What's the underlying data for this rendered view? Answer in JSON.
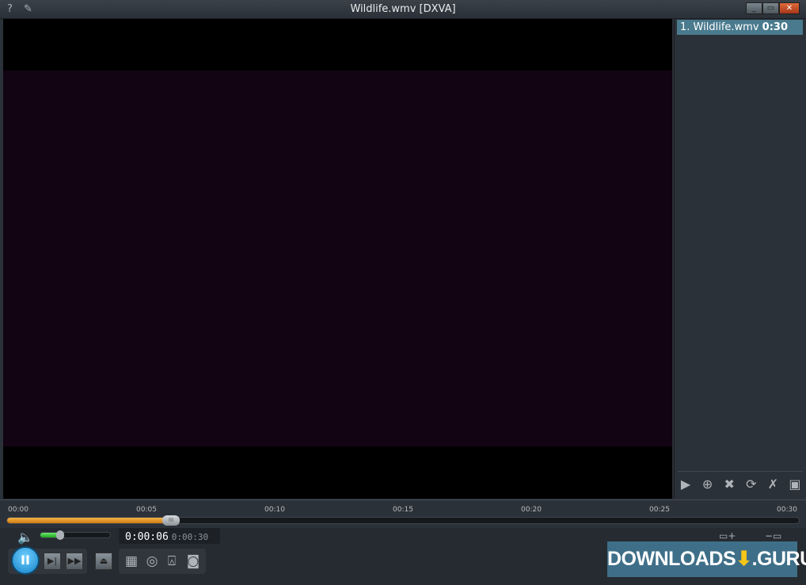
{
  "window": {
    "title": "Wildlife.wmv [DXVA]",
    "help": "?",
    "pin": "📌"
  },
  "playlist": {
    "items": [
      {
        "index": "1.",
        "name": "Wildlife.wmv",
        "duration": "0:30"
      }
    ]
  },
  "timeline": {
    "ticks": [
      "00:00",
      "00:05",
      "00:10",
      "00:15",
      "00:20",
      "00:25",
      "00:30"
    ],
    "progress_fraction": 0.2
  },
  "controls": {
    "current_time": "0:00:06",
    "total_time": "0:00:30",
    "volume_fraction": 0.27
  },
  "watermark": "DOWNLOADS⬇.GURU"
}
